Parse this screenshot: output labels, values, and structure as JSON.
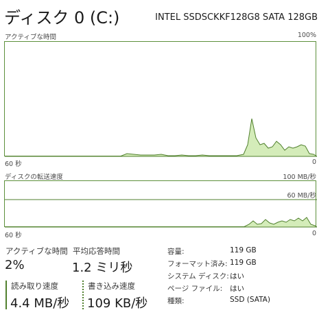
{
  "header": {
    "title": "ディスク 0 (C:)",
    "model": "INTEL SSDSCKKF128G8 SATA 128GB"
  },
  "active_time_graph": {
    "label": "アクティブな時間",
    "max_label": "100%",
    "time_label": "60 秒",
    "min_label": "0",
    "line_color": "#4f7f2c",
    "fill_color": "#d4ecb9"
  },
  "transfer_graph": {
    "label": "ディスクの転送速度",
    "max_label": "100 MB/秒",
    "ref_label": "60 MB/秒",
    "time_label": "60 秒",
    "min_label": "0",
    "line_color": "#4f7f2c",
    "fill_color": "#d4ecb9"
  },
  "stats": {
    "active_time": {
      "label": "アクティブな時間",
      "value": "2%"
    },
    "avg_response": {
      "label": "平均応答時間",
      "value": "1.2 ミリ秒"
    },
    "read_speed": {
      "label": "読み取り速度",
      "value": "4.4 MB/秒"
    },
    "write_speed": {
      "label": "書き込み速度",
      "value": "109 KB/秒"
    }
  },
  "properties": [
    {
      "label": "容量:",
      "value": "119 GB"
    },
    {
      "label": "フォーマット済み:",
      "value": "119 GB"
    },
    {
      "label": "システム ディスク:",
      "value": "はい"
    },
    {
      "label": "ページ ファイル:",
      "value": "はい"
    },
    {
      "label": "種類:",
      "value": "SSD (SATA)"
    }
  ]
}
